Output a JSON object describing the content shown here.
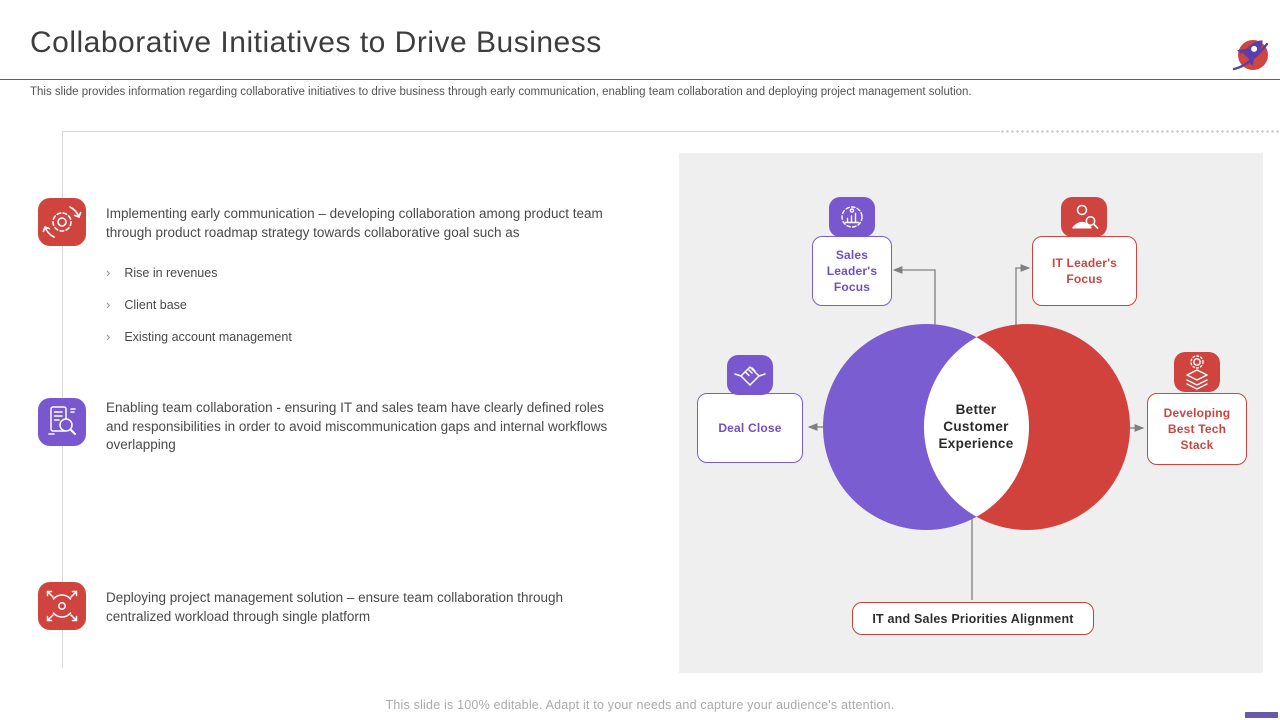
{
  "slide": {
    "title": "Collaborative Initiatives to Drive Business",
    "subtitle": "This slide provides information regarding collaborative initiatives to drive business through early communication, enabling team collaboration and deploying project management solution.",
    "footer": "This slide is 100% editable. Adapt it to your needs and capture your audience's attention."
  },
  "ui": {
    "bullet_marker": "›"
  },
  "colors": {
    "accent_red": "#d0443f",
    "accent_purple": "#7957cf",
    "venn_purple": "#7a5ed1",
    "venn_red": "#d2423d",
    "rule_red": "#9d4a41",
    "panel_gray": "#efeff0",
    "connector_gray": "#7f7f7f"
  },
  "items": [
    {
      "icon": "gear-sync-icon",
      "text": "Implementing early communication – developing collaboration among product team through product roadmap strategy towards collaborative goal such as",
      "bullets": [
        "Rise in revenues",
        "Client base",
        "Existing account management"
      ]
    },
    {
      "icon": "team-audit-icon",
      "text": "Enabling team collaboration - ensuring IT and sales team have clearly defined roles and responsibilities in order to avoid miscommunication gaps and internal workflows overlapping",
      "bullets": []
    },
    {
      "icon": "deploy-icon",
      "text": "Deploying project management solution – ensure team collaboration through centralized workload through single platform",
      "bullets": []
    }
  ],
  "diagram": {
    "center_label": "Better Customer Experience",
    "bottom_label": "IT and Sales Priorities Alignment",
    "callouts": [
      {
        "label": "Sales Leader's Focus",
        "color": "purple",
        "icon": "gear-chart-icon"
      },
      {
        "label": "IT Leader's Focus",
        "color": "red",
        "icon": "person-search-icon"
      },
      {
        "label": "Deal Close",
        "color": "purple",
        "icon": "handshake-icon"
      },
      {
        "label": "Developing Best Tech Stack",
        "color": "red",
        "icon": "tech-stack-icon"
      }
    ]
  }
}
